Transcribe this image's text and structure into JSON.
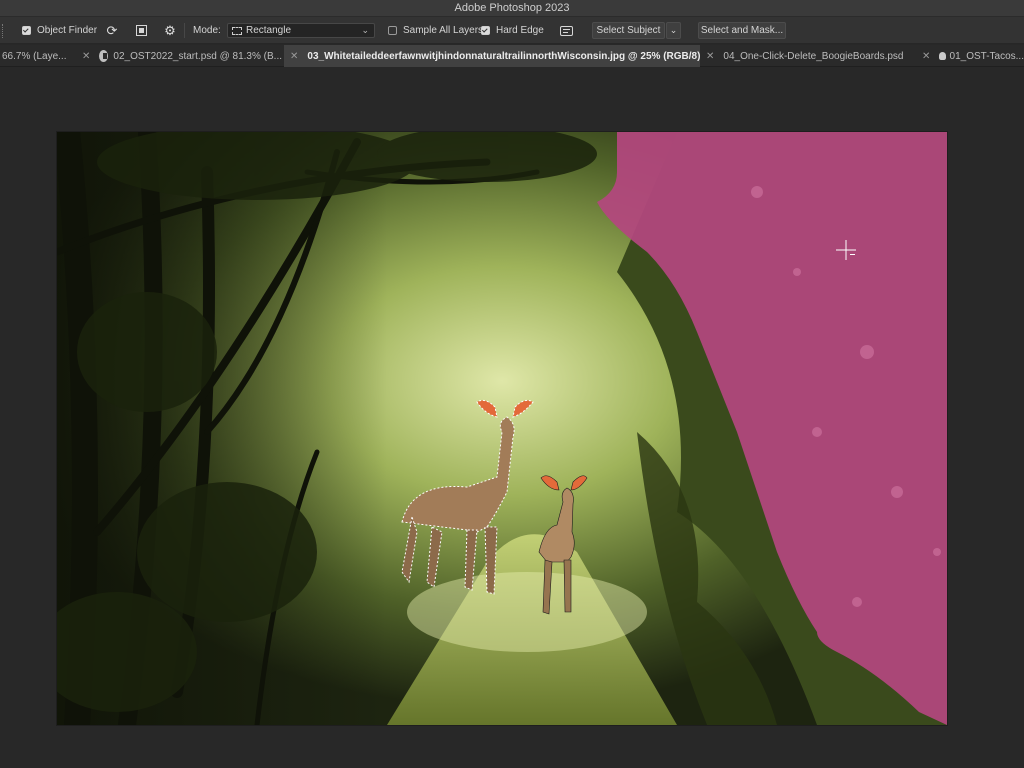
{
  "app": {
    "title": "Adobe Photoshop 2023"
  },
  "options": {
    "object_finder": {
      "label": "Object Finder",
      "checked": true
    },
    "refresh_icon": "refresh-icon",
    "settings_icon": "gear-icon",
    "mode": {
      "label": "Mode:",
      "value": "Rectangle"
    },
    "sample_all_layers": {
      "label": "Sample All Layers",
      "checked": false
    },
    "hard_edge": {
      "label": "Hard Edge",
      "checked": true
    },
    "select_subject": "Select Subject",
    "select_and_mask": "Select and Mask..."
  },
  "tabs": [
    {
      "label": "66.7% (Laye...",
      "active": false
    },
    {
      "label": "02_OST2022_start.psd @ 81.3% (B...",
      "active": false
    },
    {
      "label": "03_WhitetaileddeerfawnwitjhindonnaturaltrailinnorthWisconsin.jpg @ 25% (RGB/8)",
      "active": true
    },
    {
      "label": "04_One-Click-Delete_BoogieBoards.psd",
      "active": false
    },
    {
      "label": "01_OST-Tacos...",
      "active": false
    }
  ],
  "colors": {
    "overlay": "#b4467f",
    "accent_ear": "#e36a3a",
    "deer": "#a27c58"
  }
}
